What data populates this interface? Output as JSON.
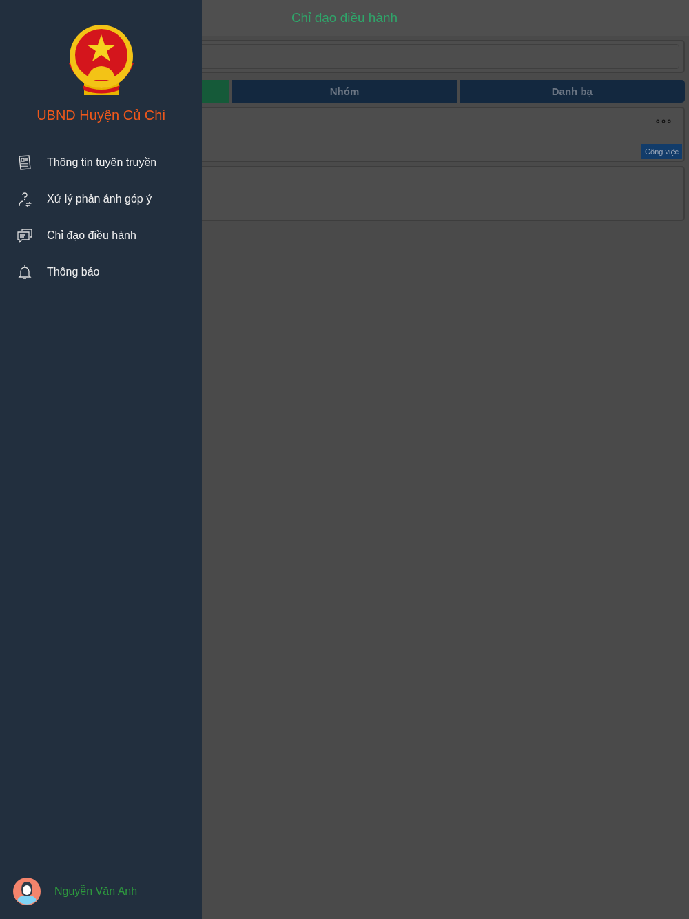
{
  "header": {
    "title": "Chỉ đạo điều hành"
  },
  "tabs": [
    {
      "selected": true
    },
    {
      "label": "Nhóm",
      "selected": false
    },
    {
      "label": "Danh bạ",
      "selected": false
    }
  ],
  "cards": [
    {
      "has_more": true,
      "tag": "Công việc"
    },
    {
      "has_more": false
    }
  ],
  "drawer": {
    "title": "UBND Huyện Củ Chi",
    "items": [
      {
        "kind": "news",
        "label": "Thông tin tuyên truyền"
      },
      {
        "kind": "feedback",
        "label": "Xử lý phản ánh góp ý"
      },
      {
        "kind": "chat",
        "label": "Chỉ đạo điều hành"
      },
      {
        "kind": "bell",
        "label": "Thông báo"
      }
    ],
    "user": {
      "name": "Nguyễn Văn Anh"
    }
  }
}
